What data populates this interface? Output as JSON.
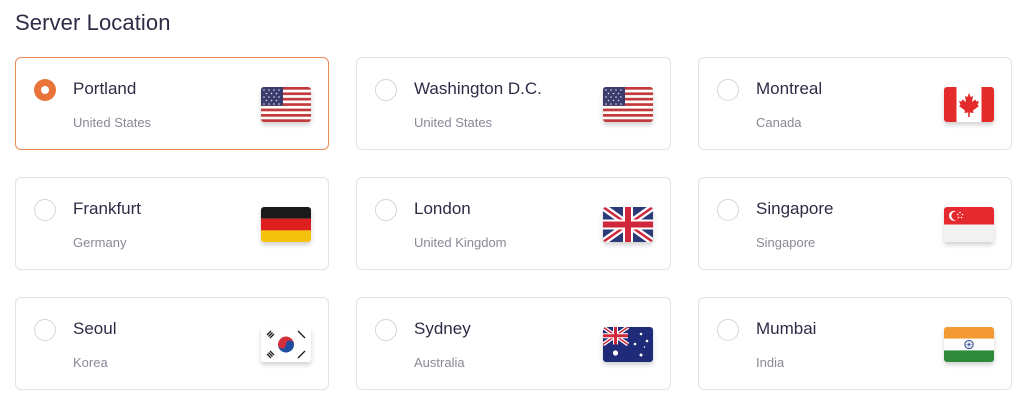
{
  "title": "Server Location",
  "selected_index": 0,
  "locations": [
    {
      "city": "Portland",
      "country": "United States",
      "flag": "us-flag-icon"
    },
    {
      "city": "Washington D.C.",
      "country": "United States",
      "flag": "us-flag-icon"
    },
    {
      "city": "Montreal",
      "country": "Canada",
      "flag": "canada-flag-icon"
    },
    {
      "city": "Frankfurt",
      "country": "Germany",
      "flag": "germany-flag-icon"
    },
    {
      "city": "London",
      "country": "United Kingdom",
      "flag": "uk-flag-icon"
    },
    {
      "city": "Singapore",
      "country": "Singapore",
      "flag": "singapore-flag-icon"
    },
    {
      "city": "Seoul",
      "country": "Korea",
      "flag": "korea-flag-icon"
    },
    {
      "city": "Sydney",
      "country": "Australia",
      "flag": "australia-flag-icon"
    },
    {
      "city": "Mumbai",
      "country": "India",
      "flag": "india-flag-icon"
    }
  ],
  "colors": {
    "accent": "#e9743a",
    "selected_border": "#e98b55",
    "card_border": "#e3e3e8"
  }
}
